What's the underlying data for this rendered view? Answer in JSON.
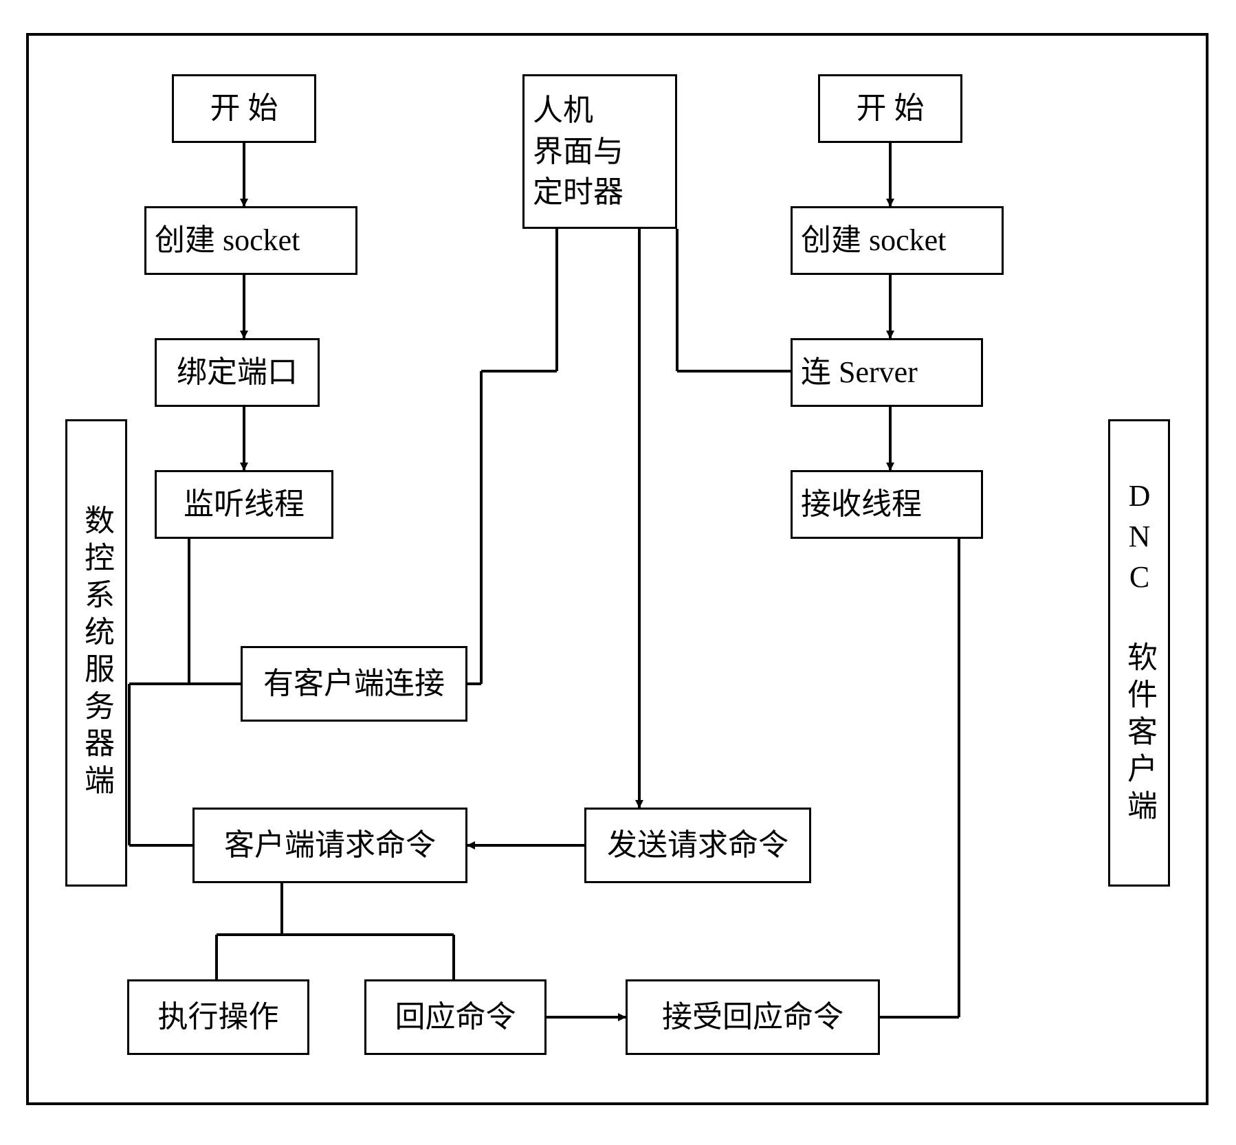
{
  "outer_frame": "",
  "labels": {
    "server_side": "数控系统服务器端",
    "client_side": "DNC 软件客户端"
  },
  "left_flow": {
    "start": "开 始",
    "create_socket": "创建 socket",
    "bind_port": "绑定端口",
    "listen_thread": "监听线程",
    "client_connected": "有客户端连接",
    "client_request": "客户端请求命令",
    "exec_op": "执行操作",
    "reply_cmd": "回应命令"
  },
  "center": {
    "hmi_timer": "人机\n界面与\n定时器",
    "send_request": "发送请求命令",
    "recv_reply": "接受回应命令"
  },
  "right_flow": {
    "start": "开 始",
    "create_socket": "创建 socket",
    "connect_server": "连 Server",
    "recv_thread": "接收线程"
  }
}
